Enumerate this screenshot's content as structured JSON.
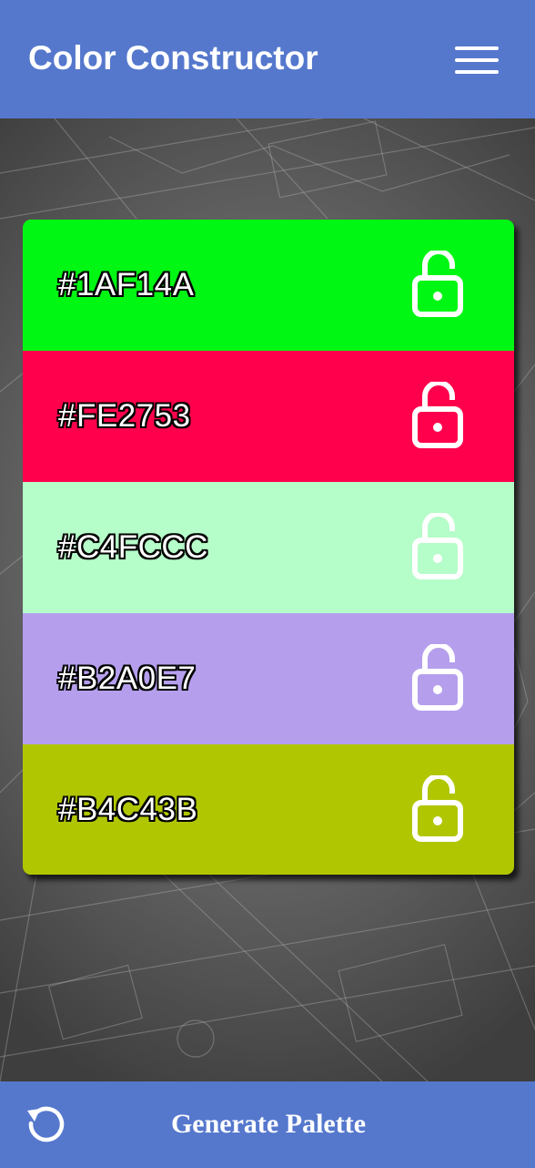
{
  "header": {
    "title": "Color Constructor",
    "menu_icon": "hamburger-menu-icon",
    "background_color": "#5578CD"
  },
  "palette": {
    "swatches": [
      {
        "hex": "#1AF14A",
        "color": "#00F713",
        "locked": false,
        "icon": "unlocked-padlock-icon"
      },
      {
        "hex": "#FE2753",
        "color": "#FF004C",
        "locked": false,
        "icon": "unlocked-padlock-icon"
      },
      {
        "hex": "#C4FCCC",
        "color": "#B5FDC9",
        "locked": false,
        "icon": "unlocked-padlock-icon"
      },
      {
        "hex": "#B2A0E7",
        "color": "#B59FED",
        "locked": false,
        "icon": "unlocked-padlock-icon"
      },
      {
        "hex": "#B4C43B",
        "color": "#B0C600",
        "locked": false,
        "icon": "unlocked-padlock-icon"
      }
    ]
  },
  "footer": {
    "refresh_icon": "refresh-icon",
    "generate_label": "Generate Palette",
    "background_color": "#5578CD"
  }
}
